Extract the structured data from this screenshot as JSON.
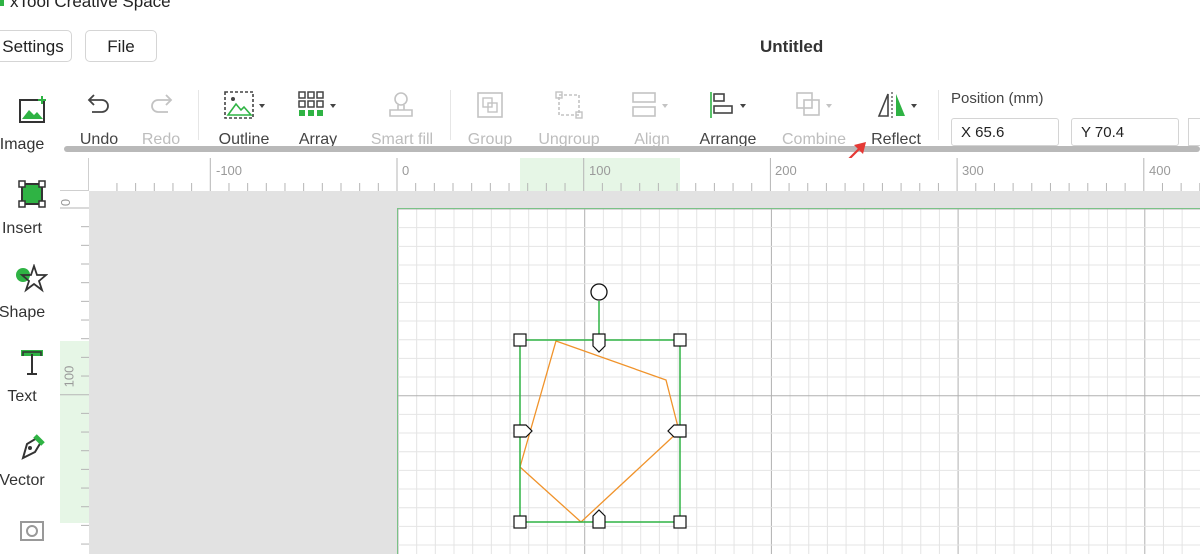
{
  "app": {
    "title": "xTool Creative Space",
    "document_title": "Untitled"
  },
  "menu": {
    "settings": "Settings",
    "file": "File"
  },
  "left_toolbar": [
    {
      "label": "Image",
      "icon": "image-add-icon"
    },
    {
      "label": "Insert",
      "icon": "insert-icon"
    },
    {
      "label": "Shape",
      "icon": "shape-icon"
    },
    {
      "label": "Text",
      "icon": "text-icon"
    },
    {
      "label": "Vector",
      "icon": "pen-icon"
    }
  ],
  "top_toolbar": {
    "undo": "Undo",
    "redo": "Redo",
    "outline": "Outline",
    "array": "Array",
    "smart_fill": "Smart fill",
    "group": "Group",
    "ungroup": "Ungroup",
    "align": "Align",
    "arrange": "Arrange",
    "combine": "Combine",
    "reflect": "Reflect"
  },
  "position": {
    "label": "Position (mm)",
    "x": "X 65.6",
    "y": "Y 70.4"
  },
  "ruler": {
    "top_labels": [
      "-100",
      "0",
      "100",
      "200",
      "300",
      "400"
    ],
    "left_labels": [
      "0",
      "100"
    ]
  },
  "colors": {
    "accent": "#2fb344",
    "shape_stroke": "#f0932b",
    "arrow": "#e53935"
  }
}
